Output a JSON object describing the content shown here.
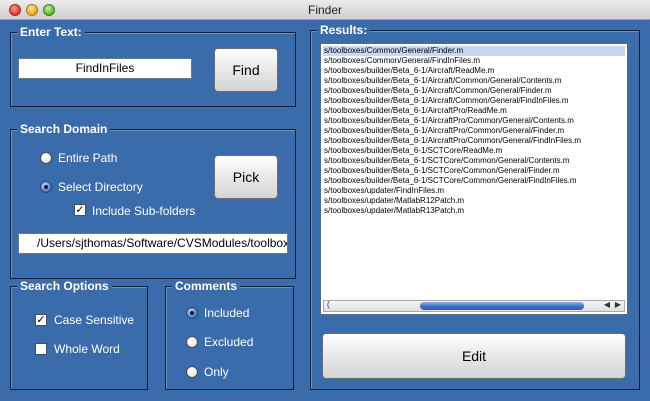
{
  "window": {
    "title": "Finder"
  },
  "enter_text": {
    "title": "Enter Text:",
    "value": "FindInFiles",
    "find_label": "Find"
  },
  "search_domain": {
    "title": "Search Domain",
    "entire_path_label": "Entire Path",
    "select_directory_label": "Select Directory",
    "include_subfolders_label": "Include Sub-folders",
    "pick_label": "Pick",
    "directory_value": "/Users/sjthomas/Software/CVSModules/toolboxes",
    "selected": "Select Directory",
    "include_subfolders": true
  },
  "search_options": {
    "title": "Search Options",
    "case_sensitive_label": "Case Sensitive",
    "case_sensitive": true,
    "whole_word_label": "Whole Word",
    "whole_word": false
  },
  "comments": {
    "title": "Comments",
    "options": [
      "Included",
      "Excluded",
      "Only"
    ],
    "selected": "Included"
  },
  "results": {
    "title": "Results:",
    "items": [
      "s/toolboxes/Common/General/Finder.m",
      "s/toolboxes/Common/General/FindInFiles.m",
      "s/toolboxes/builder/Beta_6-1/Aircraft/ReadMe.m",
      "s/toolboxes/builder/Beta_6-1/Aircraft/Common/General/Contents.m",
      "s/toolboxes/builder/Beta_6-1/Aircraft/Common/General/Finder.m",
      "s/toolboxes/builder/Beta_6-1/Aircraft/Common/General/FindInFiles.m",
      "s/toolboxes/builder/Beta_6-1/AircraftPro/ReadMe.m",
      "s/toolboxes/builder/Beta_6-1/AircraftPro/Common/General/Contents.m",
      "s/toolboxes/builder/Beta_6-1/AircraftPro/Common/General/Finder.m",
      "s/toolboxes/builder/Beta_6-1/AircraftPro/Common/General/FindInFiles.m",
      "s/toolboxes/builder/Beta_6-1/SCTCore/ReadMe.m",
      "s/toolboxes/builder/Beta_6-1/SCTCore/Common/General/Contents.m",
      "s/toolboxes/builder/Beta_6-1/SCTCore/Common/General/Finder.m",
      "s/toolboxes/builder/Beta_6-1/SCTCore/Common/General/FindInFiles.m",
      "s/toolboxes/updater/FindInFiles.m",
      "s/toolboxes/updater/MatlabR12Patch.m",
      "s/toolboxes/updater/MatlabR13Patch.m"
    ],
    "selected_index": 0
  },
  "edit_label": "Edit",
  "colors": {
    "background": "#3a6bab",
    "panel_border": "#0f1f3a",
    "selection": "#c7d8f3"
  }
}
